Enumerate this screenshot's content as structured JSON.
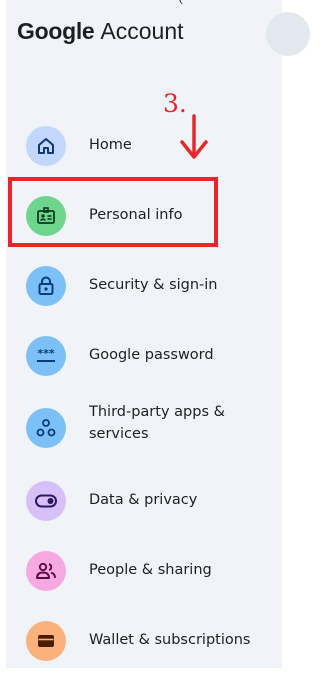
{
  "top_fragment_text": "(",
  "header": {
    "brand_google": "Google",
    "brand_account": "Account"
  },
  "annotation": {
    "step_label": "3."
  },
  "nav": {
    "items": [
      {
        "label": "Home",
        "icon": "home-icon",
        "color": "#c2d7fb"
      },
      {
        "label": "Personal info",
        "icon": "id-card-icon",
        "color": "#6dd58c"
      },
      {
        "label": "Security & sign-in",
        "icon": "lock-icon",
        "color": "#7cc0f8"
      },
      {
        "label": "Google password",
        "icon": "password-icon",
        "color": "#7cc0f8"
      },
      {
        "label": "Third-party apps & services",
        "label_line1": "Third-party apps &",
        "label_line2": "services",
        "icon": "connected-apps-icon",
        "color": "#7cc0f8"
      },
      {
        "label": "Data & privacy",
        "icon": "toggle-icon",
        "color": "#d7c0f8"
      },
      {
        "label": "People & sharing",
        "icon": "people-icon",
        "color": "#f6a9e0"
      },
      {
        "label": "Wallet & subscriptions",
        "icon": "wallet-icon",
        "color": "#f9b27b"
      }
    ]
  },
  "colors": {
    "sidebar_background": "#f0f4f9",
    "annotation_red": "#e8262b",
    "icon_foreground": "#0b3a78"
  }
}
